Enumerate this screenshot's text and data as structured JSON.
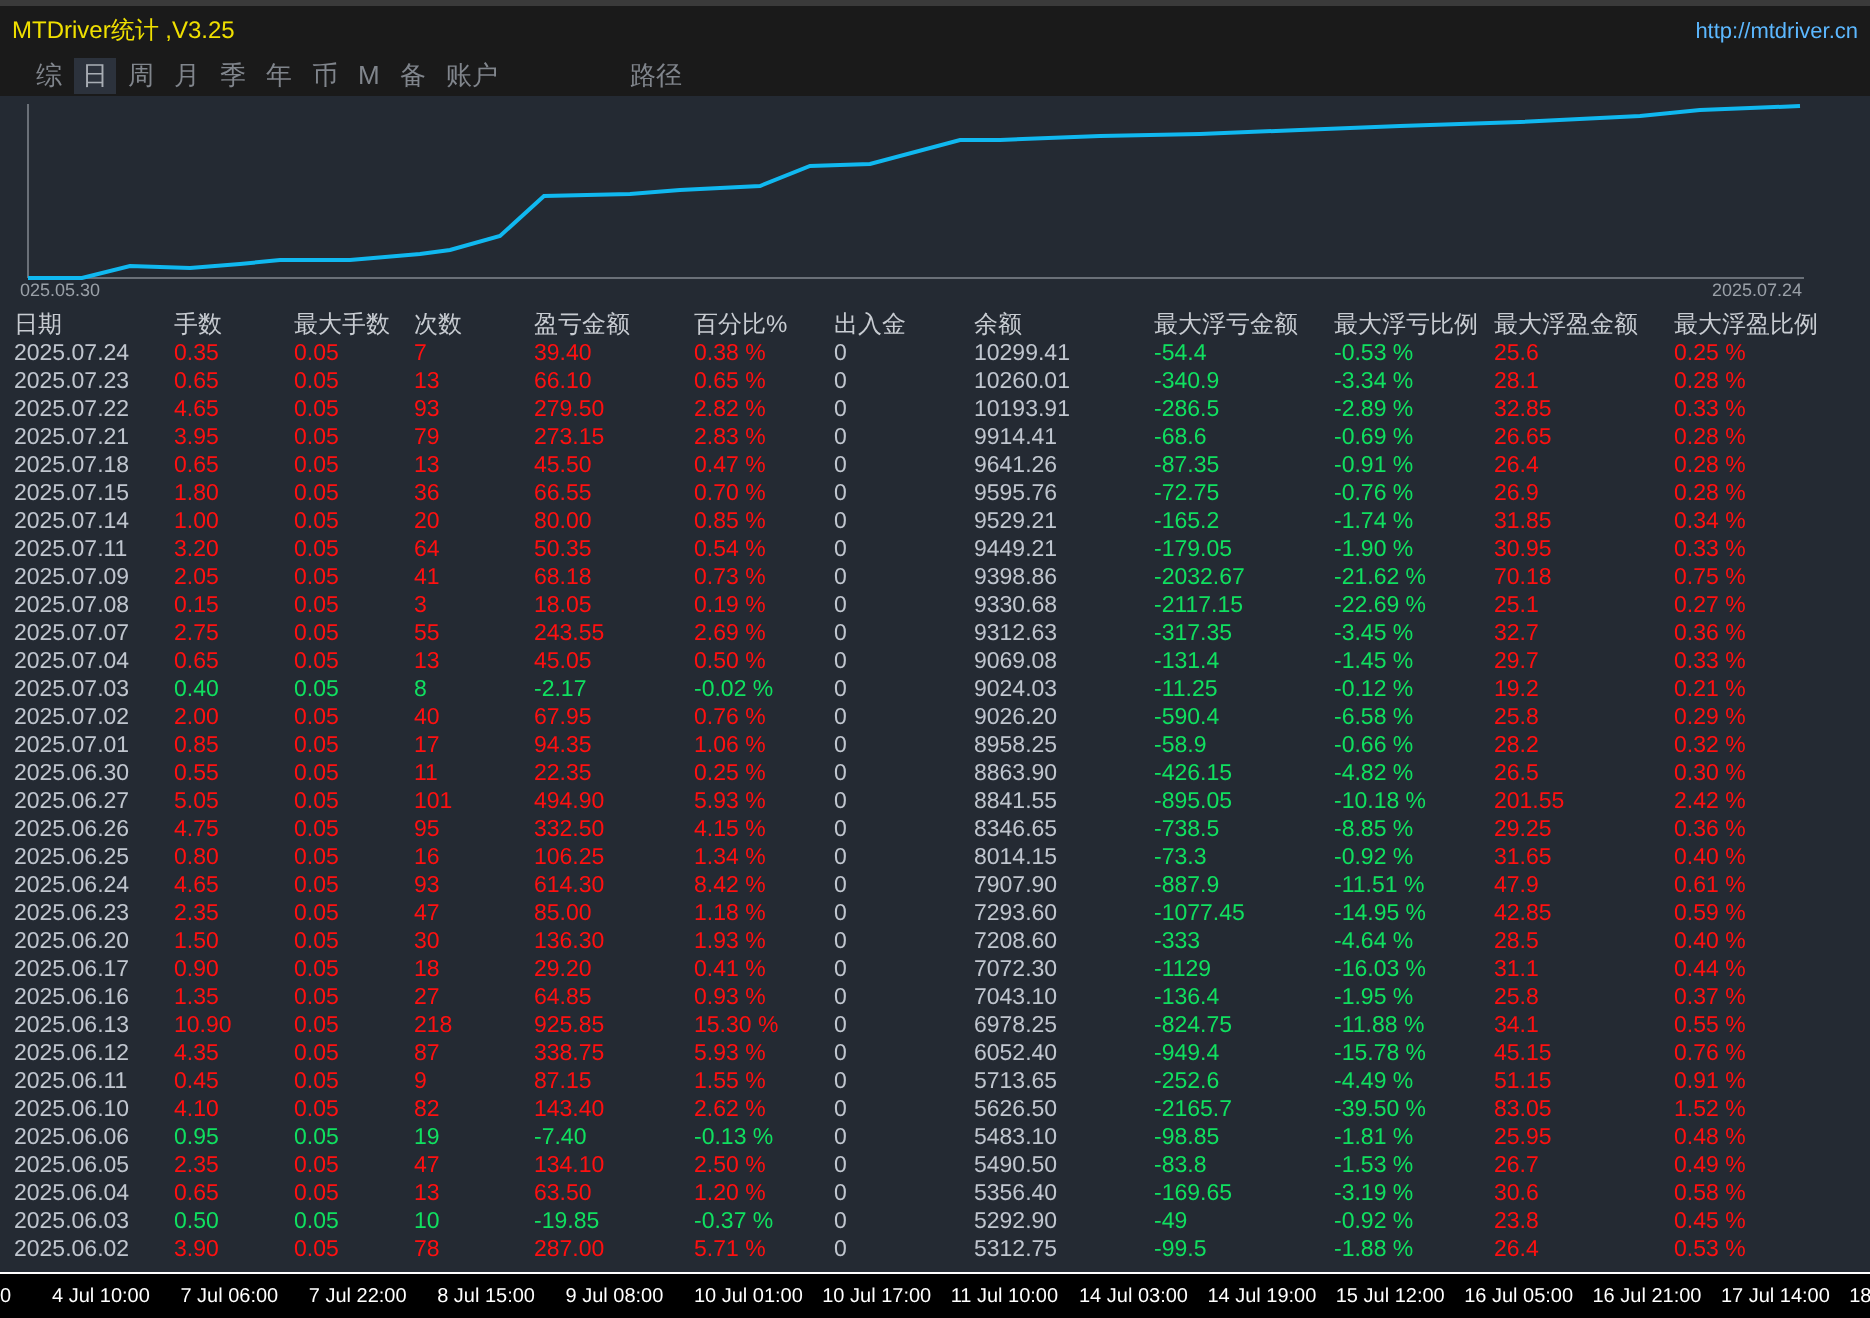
{
  "window": {
    "title": "MTDriver统计 ,V3.25",
    "url": "http://mtdriver.cn"
  },
  "tabs": [
    {
      "label": "综",
      "selected": false
    },
    {
      "label": "日",
      "selected": true
    },
    {
      "label": "周",
      "selected": false
    },
    {
      "label": "月",
      "selected": false
    },
    {
      "label": "季",
      "selected": false
    },
    {
      "label": "年",
      "selected": false
    },
    {
      "label": "币",
      "selected": false
    },
    {
      "label": "M",
      "selected": false
    },
    {
      "label": "备",
      "selected": false
    },
    {
      "label": "账户",
      "selected": false
    }
  ],
  "route_tab": {
    "label": "路径",
    "selected": false
  },
  "chart": {
    "start_label": "025.05.30",
    "end_label": "2025.07.24"
  },
  "table": {
    "columns": [
      "日期",
      "手数",
      "最大手数",
      "次数",
      "盈亏金额",
      "百分比%",
      "出入金",
      "余额",
      "最大浮亏金额",
      "最大浮亏比例",
      "最大浮盈金额",
      "最大浮盈比例"
    ],
    "rows": [
      {
        "kind": "gain",
        "cells": [
          "2025.07.24",
          "0.35",
          "0.05",
          "7",
          "39.40",
          "0.38 %",
          "0",
          "10299.41",
          "-54.4",
          "-0.53 %",
          "25.6",
          "0.25 %"
        ]
      },
      {
        "kind": "gain",
        "cells": [
          "2025.07.23",
          "0.65",
          "0.05",
          "13",
          "66.10",
          "0.65 %",
          "0",
          "10260.01",
          "-340.9",
          "-3.34 %",
          "28.1",
          "0.28 %"
        ]
      },
      {
        "kind": "gain",
        "cells": [
          "2025.07.22",
          "4.65",
          "0.05",
          "93",
          "279.50",
          "2.82 %",
          "0",
          "10193.91",
          "-286.5",
          "-2.89 %",
          "32.85",
          "0.33 %"
        ]
      },
      {
        "kind": "gain",
        "cells": [
          "2025.07.21",
          "3.95",
          "0.05",
          "79",
          "273.15",
          "2.83 %",
          "0",
          "9914.41",
          "-68.6",
          "-0.69 %",
          "26.65",
          "0.28 %"
        ]
      },
      {
        "kind": "gain",
        "cells": [
          "2025.07.18",
          "0.65",
          "0.05",
          "13",
          "45.50",
          "0.47 %",
          "0",
          "9641.26",
          "-87.35",
          "-0.91 %",
          "26.4",
          "0.28 %"
        ]
      },
      {
        "kind": "gain",
        "cells": [
          "2025.07.15",
          "1.80",
          "0.05",
          "36",
          "66.55",
          "0.70 %",
          "0",
          "9595.76",
          "-72.75",
          "-0.76 %",
          "26.9",
          "0.28 %"
        ]
      },
      {
        "kind": "gain",
        "cells": [
          "2025.07.14",
          "1.00",
          "0.05",
          "20",
          "80.00",
          "0.85 %",
          "0",
          "9529.21",
          "-165.2",
          "-1.74 %",
          "31.85",
          "0.34 %"
        ]
      },
      {
        "kind": "gain",
        "cells": [
          "2025.07.11",
          "3.20",
          "0.05",
          "64",
          "50.35",
          "0.54 %",
          "0",
          "9449.21",
          "-179.05",
          "-1.90 %",
          "30.95",
          "0.33 %"
        ]
      },
      {
        "kind": "gain",
        "cells": [
          "2025.07.09",
          "2.05",
          "0.05",
          "41",
          "68.18",
          "0.73 %",
          "0",
          "9398.86",
          "-2032.67",
          "-21.62 %",
          "70.18",
          "0.75 %"
        ]
      },
      {
        "kind": "gain",
        "cells": [
          "2025.07.08",
          "0.15",
          "0.05",
          "3",
          "18.05",
          "0.19 %",
          "0",
          "9330.68",
          "-2117.15",
          "-22.69 %",
          "25.1",
          "0.27 %"
        ]
      },
      {
        "kind": "gain",
        "cells": [
          "2025.07.07",
          "2.75",
          "0.05",
          "55",
          "243.55",
          "2.69 %",
          "0",
          "9312.63",
          "-317.35",
          "-3.45 %",
          "32.7",
          "0.36 %"
        ]
      },
      {
        "kind": "gain",
        "cells": [
          "2025.07.04",
          "0.65",
          "0.05",
          "13",
          "45.05",
          "0.50 %",
          "0",
          "9069.08",
          "-131.4",
          "-1.45 %",
          "29.7",
          "0.33 %"
        ]
      },
      {
        "kind": "loss",
        "cells": [
          "2025.07.03",
          "0.40",
          "0.05",
          "8",
          "-2.17",
          "-0.02 %",
          "0",
          "9024.03",
          "-11.25",
          "-0.12 %",
          "19.2",
          "0.21 %"
        ]
      },
      {
        "kind": "gain",
        "cells": [
          "2025.07.02",
          "2.00",
          "0.05",
          "40",
          "67.95",
          "0.76 %",
          "0",
          "9026.20",
          "-590.4",
          "-6.58 %",
          "25.8",
          "0.29 %"
        ]
      },
      {
        "kind": "gain",
        "cells": [
          "2025.07.01",
          "0.85",
          "0.05",
          "17",
          "94.35",
          "1.06 %",
          "0",
          "8958.25",
          "-58.9",
          "-0.66 %",
          "28.2",
          "0.32 %"
        ]
      },
      {
        "kind": "gain",
        "cells": [
          "2025.06.30",
          "0.55",
          "0.05",
          "11",
          "22.35",
          "0.25 %",
          "0",
          "8863.90",
          "-426.15",
          "-4.82 %",
          "26.5",
          "0.30 %"
        ]
      },
      {
        "kind": "gain",
        "cells": [
          "2025.06.27",
          "5.05",
          "0.05",
          "101",
          "494.90",
          "5.93 %",
          "0",
          "8841.55",
          "-895.05",
          "-10.18 %",
          "201.55",
          "2.42 %"
        ]
      },
      {
        "kind": "gain",
        "cells": [
          "2025.06.26",
          "4.75",
          "0.05",
          "95",
          "332.50",
          "4.15 %",
          "0",
          "8346.65",
          "-738.5",
          "-8.85 %",
          "29.25",
          "0.36 %"
        ]
      },
      {
        "kind": "gain",
        "cells": [
          "2025.06.25",
          "0.80",
          "0.05",
          "16",
          "106.25",
          "1.34 %",
          "0",
          "8014.15",
          "-73.3",
          "-0.92 %",
          "31.65",
          "0.40 %"
        ]
      },
      {
        "kind": "gain",
        "cells": [
          "2025.06.24",
          "4.65",
          "0.05",
          "93",
          "614.30",
          "8.42 %",
          "0",
          "7907.90",
          "-887.9",
          "-11.51 %",
          "47.9",
          "0.61 %"
        ]
      },
      {
        "kind": "gain",
        "cells": [
          "2025.06.23",
          "2.35",
          "0.05",
          "47",
          "85.00",
          "1.18 %",
          "0",
          "7293.60",
          "-1077.45",
          "-14.95 %",
          "42.85",
          "0.59 %"
        ]
      },
      {
        "kind": "gain",
        "cells": [
          "2025.06.20",
          "1.50",
          "0.05",
          "30",
          "136.30",
          "1.93 %",
          "0",
          "7208.60",
          "-333",
          "-4.64 %",
          "28.5",
          "0.40 %"
        ]
      },
      {
        "kind": "gain",
        "cells": [
          "2025.06.17",
          "0.90",
          "0.05",
          "18",
          "29.20",
          "0.41 %",
          "0",
          "7072.30",
          "-1129",
          "-16.03 %",
          "31.1",
          "0.44 %"
        ]
      },
      {
        "kind": "gain",
        "cells": [
          "2025.06.16",
          "1.35",
          "0.05",
          "27",
          "64.85",
          "0.93 %",
          "0",
          "7043.10",
          "-136.4",
          "-1.95 %",
          "25.8",
          "0.37 %"
        ]
      },
      {
        "kind": "gain",
        "cells": [
          "2025.06.13",
          "10.90",
          "0.05",
          "218",
          "925.85",
          "15.30 %",
          "0",
          "6978.25",
          "-824.75",
          "-11.88 %",
          "34.1",
          "0.55 %"
        ]
      },
      {
        "kind": "gain",
        "cells": [
          "2025.06.12",
          "4.35",
          "0.05",
          "87",
          "338.75",
          "5.93 %",
          "0",
          "6052.40",
          "-949.4",
          "-15.78 %",
          "45.15",
          "0.76 %"
        ]
      },
      {
        "kind": "gain",
        "cells": [
          "2025.06.11",
          "0.45",
          "0.05",
          "9",
          "87.15",
          "1.55 %",
          "0",
          "5713.65",
          "-252.6",
          "-4.49 %",
          "51.15",
          "0.91 %"
        ]
      },
      {
        "kind": "gain",
        "cells": [
          "2025.06.10",
          "4.10",
          "0.05",
          "82",
          "143.40",
          "2.62 %",
          "0",
          "5626.50",
          "-2165.7",
          "-39.50 %",
          "83.05",
          "1.52 %"
        ]
      },
      {
        "kind": "loss",
        "cells": [
          "2025.06.06",
          "0.95",
          "0.05",
          "19",
          "-7.40",
          "-0.13 %",
          "0",
          "5483.10",
          "-98.85",
          "-1.81 %",
          "25.95",
          "0.48 %"
        ]
      },
      {
        "kind": "gain",
        "cells": [
          "2025.06.05",
          "2.35",
          "0.05",
          "47",
          "134.10",
          "2.50 %",
          "0",
          "5490.50",
          "-83.8",
          "-1.53 %",
          "26.7",
          "0.49 %"
        ]
      },
      {
        "kind": "gain",
        "cells": [
          "2025.06.04",
          "0.65",
          "0.05",
          "13",
          "63.50",
          "1.20 %",
          "0",
          "5356.40",
          "-169.65",
          "-3.19 %",
          "30.6",
          "0.58 %"
        ]
      },
      {
        "kind": "loss",
        "cells": [
          "2025.06.03",
          "0.50",
          "0.05",
          "10",
          "-19.85",
          "-0.37 %",
          "0",
          "5292.90",
          "-49",
          "-0.92 %",
          "23.8",
          "0.45 %"
        ]
      },
      {
        "kind": "gain",
        "cells": [
          "2025.06.02",
          "3.90",
          "0.05",
          "78",
          "287.00",
          "5.71 %",
          "0",
          "5312.75",
          "-99.5",
          "-1.88 %",
          "26.4",
          "0.53 %"
        ]
      }
    ]
  },
  "time_axis": [
    "0",
    "4 Jul 10:00",
    "7 Jul 06:00",
    "7 Jul 22:00",
    "8 Jul 15:00",
    "9 Jul 08:00",
    "10 Jul 01:00",
    "10 Jul 17:00",
    "11 Jul 10:00",
    "14 Jul 03:00",
    "14 Jul 19:00",
    "15 Jul 12:00",
    "16 Jul 05:00",
    "16 Jul 21:00",
    "17 Jul 14:00",
    "18"
  ]
}
